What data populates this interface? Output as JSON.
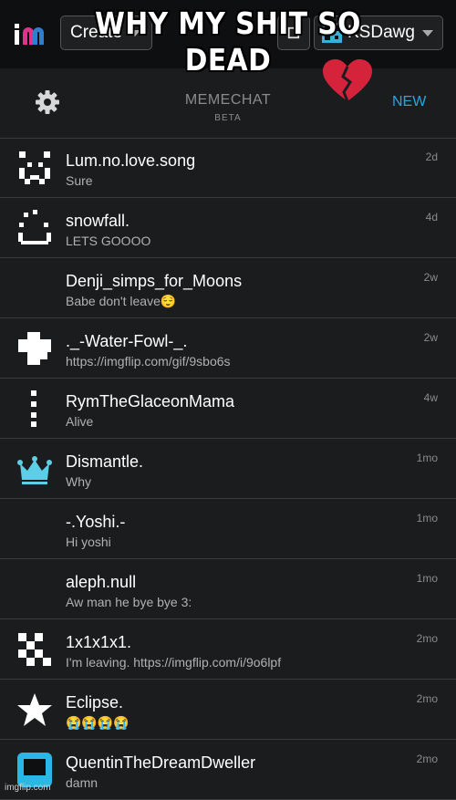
{
  "topbar": {
    "create_label": "Create",
    "username": "KSDawg",
    "colors": {
      "brand_pink": "#e0318b",
      "brand_blue": "#2f7fd0",
      "qr_cyan": "#3ab0d8"
    }
  },
  "meme": {
    "caption": "WHY MY SHIT SO DEAD",
    "emoji": "broken-heart"
  },
  "header": {
    "title": "MEMECHAT",
    "subtitle": "BETA",
    "new_label": "NEW"
  },
  "chats": [
    {
      "name": "Lum.no.love.song",
      "message": "Sure",
      "time": "2d",
      "avatar": "pixel-face-icon"
    },
    {
      "name": "snowfall.",
      "message": "LETS GOOOO",
      "time": "4d",
      "avatar": "pixel-smile-icon"
    },
    {
      "name": "Denji_simps_for_Moons",
      "message": "Babe don't leave😌",
      "time": "2w",
      "avatar": "none"
    },
    {
      "name": "._-Water-Fowl-_.",
      "message": "https://imgflip.com/gif/9sbo6s",
      "time": "2w",
      "avatar": "pixel-cross-icon"
    },
    {
      "name": "RymTheGlaceonMama",
      "message": "Alive",
      "time": "4w",
      "avatar": "pixel-dots-icon"
    },
    {
      "name": "Dismantle.",
      "message": "Why",
      "time": "1mo",
      "avatar": "crown-icon"
    },
    {
      "name": "-.Yoshi.-",
      "message": "Hi yoshi",
      "time": "1mo",
      "avatar": "none"
    },
    {
      "name": "aleph.null",
      "message": "Aw man he bye bye 3:",
      "time": "1mo",
      "avatar": "none"
    },
    {
      "name": "1x1x1x1.",
      "message": "I'm leaving. https://imgflip.com/i/9o6lpf",
      "time": "2mo",
      "avatar": "pixel-checker-icon"
    },
    {
      "name": "Eclipse.",
      "message": "😭😭😭😭",
      "time": "2mo",
      "avatar": "star-icon"
    },
    {
      "name": "QuentinTheDreamDweller",
      "message": "damn",
      "time": "2mo",
      "avatar": "tv-icon"
    }
  ],
  "footer": {
    "watermark": "imgflip.com"
  }
}
